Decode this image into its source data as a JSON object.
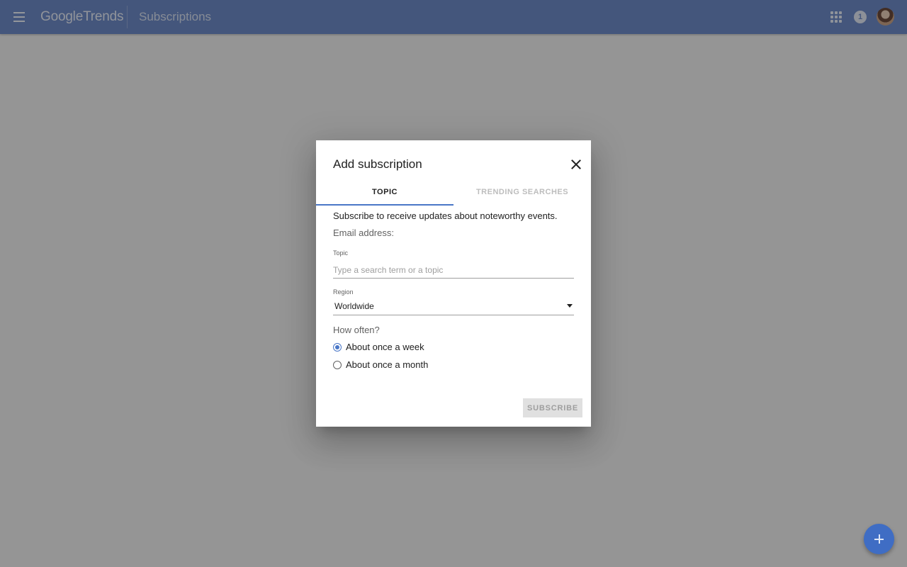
{
  "app": {
    "logo_google": "Google",
    "logo_trends": "Trends",
    "page_title": "Subscriptions",
    "notification_count": "1",
    "icons": {
      "menu": "menu-icon",
      "apps": "apps-grid-icon",
      "notification": "notification-badge",
      "avatar": "user-avatar",
      "fab": "add-icon"
    },
    "colors": {
      "appbar": "#4a6fb5",
      "accent": "#4a77c7",
      "fab": "#3f6dc4"
    }
  },
  "dialog": {
    "title": "Add subscription",
    "tabs": [
      {
        "label": "TOPIC",
        "active": true
      },
      {
        "label": "TRENDING SEARCHES",
        "active": false
      }
    ],
    "intro": "Subscribe to receive updates about noteworthy events.",
    "email_label": "Email address:",
    "topic": {
      "label": "Topic",
      "placeholder": "Type a search term or a topic",
      "value": ""
    },
    "region": {
      "label": "Region",
      "value": "Worldwide"
    },
    "how_often": {
      "label": "How often?",
      "options": [
        {
          "label": "About once a week",
          "selected": true
        },
        {
          "label": "About once a month",
          "selected": false
        }
      ]
    },
    "subscribe_label": "SUBSCRIBE"
  }
}
